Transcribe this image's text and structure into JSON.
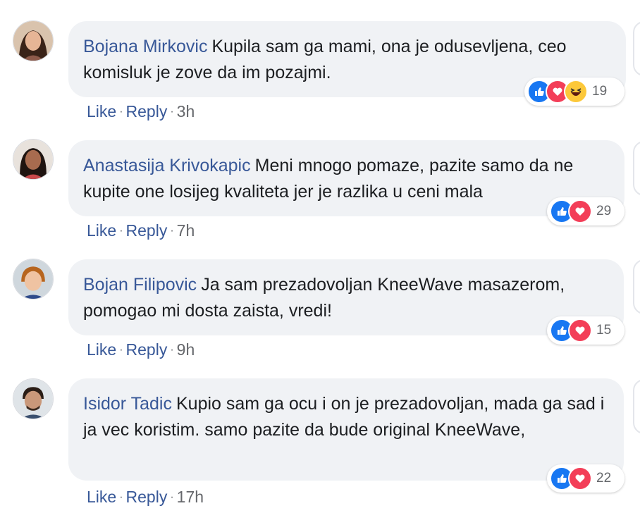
{
  "comments": [
    {
      "author": "Bojana Mirkovic",
      "text": "Kupila sam ga mami, ona je odusevljena, ceo komisluk je zove da im pozajmi.",
      "reaction_icons": [
        "like-icon",
        "love-icon",
        "haha-icon"
      ],
      "reaction_count": "19",
      "like_label": "Like",
      "reply_label": "Reply",
      "separator": "·",
      "time": "3h"
    },
    {
      "author": "Anastasija Krivokapic",
      "text": "Meni mnogo pomaze, pazite samo da ne kupite one losijeg kvaliteta jer je razlika u ceni mala",
      "reaction_icons": [
        "like-icon",
        "love-icon"
      ],
      "reaction_count": "29",
      "like_label": "Like",
      "reply_label": "Reply",
      "separator": "·",
      "time": "7h"
    },
    {
      "author": "Bojan Filipovic",
      "text": "Ja sam prezadovoljan KneeWave masazerom, pomogao mi dosta zaista, vredi!",
      "reaction_icons": [
        "like-icon",
        "love-icon"
      ],
      "reaction_count": "15",
      "like_label": "Like",
      "reply_label": "Reply",
      "separator": "·",
      "time": "9h"
    },
    {
      "author": "Isidor Tadic",
      "text": "Kupio sam ga ocu i on je prezadovoljan, mada ga sad i ja vec koristim. samo pazite da bude original KneeWave,",
      "reaction_icons": [
        "like-icon",
        "love-icon"
      ],
      "reaction_count": "22",
      "like_label": "Like",
      "reply_label": "Reply",
      "separator": "·",
      "time": "17h"
    }
  ],
  "colors": {
    "name": "#385898",
    "bubble": "#f0f2f5",
    "like": "#1877f2",
    "love": "#f33e58",
    "haha": "#fcc83a",
    "meta": "#65676b"
  }
}
